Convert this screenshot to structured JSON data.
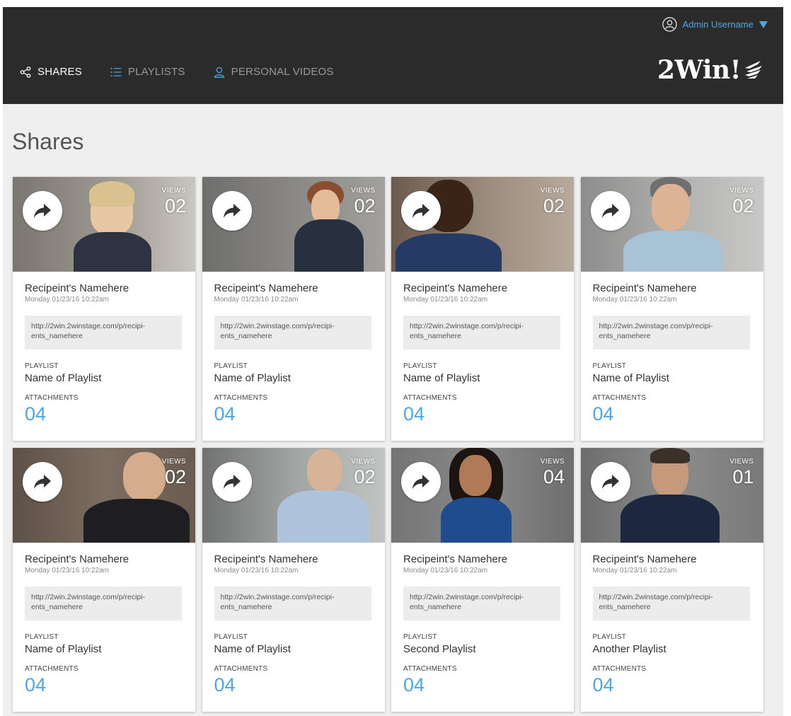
{
  "header": {
    "user_name": "Admin Username",
    "logo_text": "2Win!",
    "nav": [
      {
        "label": "SHARES",
        "icon": "share-icon",
        "active": true
      },
      {
        "label": "PLAYLISTS",
        "icon": "list-icon",
        "active": false
      },
      {
        "label": "PERSONAL VIDEOS",
        "icon": "person-icon",
        "active": false
      }
    ]
  },
  "page": {
    "title": "Shares"
  },
  "labels": {
    "views": "VIEWS",
    "playlist": "PLAYLIST",
    "attachments": "ATTACHMENTS"
  },
  "colors": {
    "accent": "#4aa8e8",
    "header_bg": "#2b2b2b",
    "page_bg": "#efefef"
  },
  "shares": [
    {
      "views": "02",
      "recipient": "Recipeint's Namehere",
      "date": "Monday 01/23/16 10:22am",
      "link_line1": "http://2win.2winstage.com/p/recipi-",
      "link_line2": "ents_namehere",
      "playlist": "Name of Playlist",
      "attachments": "04"
    },
    {
      "views": "02",
      "recipient": "Recipeint's Namehere",
      "date": "Monday 01/23/16 10:22am",
      "link_line1": "http://2win.2winstage.com/p/recipi-",
      "link_line2": "ents_namehere",
      "playlist": "Name of Playlist",
      "attachments": "04"
    },
    {
      "views": "02",
      "recipient": "Recipeint's Namehere",
      "date": "Monday 01/23/16 10:22am",
      "link_line1": "http://2win.2winstage.com/p/recipi-",
      "link_line2": "ents_namehere",
      "playlist": "Name of Playlist",
      "attachments": "04"
    },
    {
      "views": "02",
      "recipient": "Recipeint's Namehere",
      "date": "Monday 01/23/16 10:22am",
      "link_line1": "http://2win.2winstage.com/p/recipi-",
      "link_line2": "ents_namehere",
      "playlist": "Name of Playlist",
      "attachments": "04"
    },
    {
      "views": "02",
      "recipient": "Recipeint's Namehere",
      "date": "Monday 01/23/16 10:22am",
      "link_line1": "http://2win.2winstage.com/p/recipi-",
      "link_line2": "ents_namehere",
      "playlist": "Name of Playlist",
      "attachments": "04"
    },
    {
      "views": "02",
      "recipient": "Recipeint's Namehere",
      "date": "Monday 01/23/16 10:22am",
      "link_line1": "http://2win.2winstage.com/p/recipi-",
      "link_line2": "ents_namehere",
      "playlist": "Name of Playlist",
      "attachments": "04"
    },
    {
      "views": "04",
      "recipient": "Recipeint's Namehere",
      "date": "Monday 01/23/16 10:22am",
      "link_line1": "http://2win.2winstage.com/p/recipi-",
      "link_line2": "ents_namehere",
      "playlist": "Second Playlist",
      "attachments": "04"
    },
    {
      "views": "01",
      "recipient": "Recipeint's Namehere",
      "date": "Monday 01/23/16 10:22am",
      "link_line1": "http://2win.2winstage.com/p/recipi-",
      "link_line2": "ents_namehere",
      "playlist": "Another Playlist",
      "attachments": "04"
    }
  ]
}
